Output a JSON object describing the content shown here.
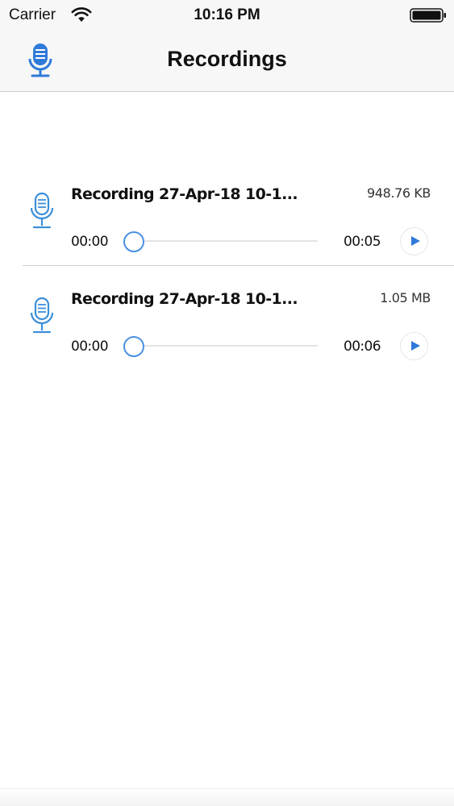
{
  "status_bar": {
    "carrier": "Carrier",
    "time": "10:16 PM",
    "icons": [
      "wifi-icon",
      "battery-icon"
    ]
  },
  "nav": {
    "title": "Recordings",
    "icon": "microphone-icon",
    "accent_color": "#2f7ad9"
  },
  "recordings": [
    {
      "title": "Recording 27-Apr-18 10-1...",
      "size": "948.76 KB",
      "current_time": "00:00",
      "duration": "00:05",
      "progress": 0
    },
    {
      "title": "Recording 27-Apr-18 10-1...",
      "size": "1.05 MB",
      "current_time": "00:00",
      "duration": "00:06",
      "progress": 0
    }
  ]
}
